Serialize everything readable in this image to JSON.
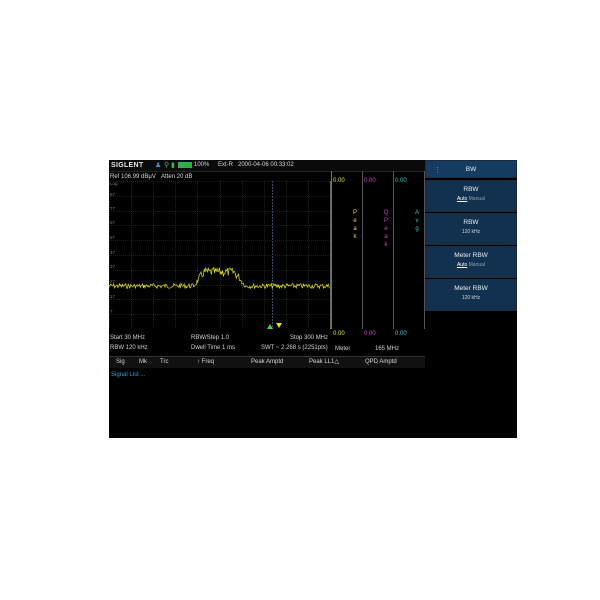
{
  "header": {
    "logo": "SIGLENT",
    "battery_pct": "100%",
    "trigger": "Ext-R",
    "datetime": "2000-04-06 00:33:02"
  },
  "status": {
    "ref": "Ref 106.99 dBµV",
    "atten": "Atten 20 dB"
  },
  "plot": {
    "scale_label": "Log",
    "div_labels": [
      "87",
      "77",
      "67",
      "57",
      "47",
      "37",
      "27",
      "17",
      "7"
    ],
    "trace_color": "#e6e600",
    "grid_color": "#3a3a3a",
    "marker_color": "#2f5fb3"
  },
  "meters": {
    "values": [
      "0.00",
      "0.00",
      "0.00"
    ],
    "bottom_values": [
      "0.00",
      "0.00",
      "0.00"
    ],
    "labels": [
      "Peak",
      "QPeak",
      "Avg"
    ],
    "colors": [
      "#e6e600",
      "#d23cd2",
      "#2ec8c8"
    ],
    "meter_label": "Meter",
    "meter_value": "165 MHz"
  },
  "info": {
    "start": "Start 30 MHz",
    "rbw_step": "RBW/Step 1.0",
    "stop": "Stop 300 MHz",
    "rbw": "RBW 120 kHz",
    "dwell": "Dwell Time 1 ms",
    "swt": "SWT ~ 2.268 s (2251pts)"
  },
  "signal_table": {
    "columns": [
      "Sig",
      "Mk",
      "Trc",
      "↑ Freq",
      "Peak Amptd",
      "Peak LL1△",
      "QPD Amptd"
    ],
    "list_label": "Signal List ..."
  },
  "softkeys": {
    "title": "BW",
    "more_icon": "⋮",
    "items": [
      {
        "label": "RBW",
        "auto": "Auto",
        "manual": "Manual"
      },
      {
        "label": "RBW",
        "value": "120 kHz"
      },
      {
        "label": "Meter RBW",
        "auto": "Auto",
        "manual": "Manual"
      },
      {
        "label": "Meter RBW",
        "value": "120 kHz"
      }
    ]
  }
}
